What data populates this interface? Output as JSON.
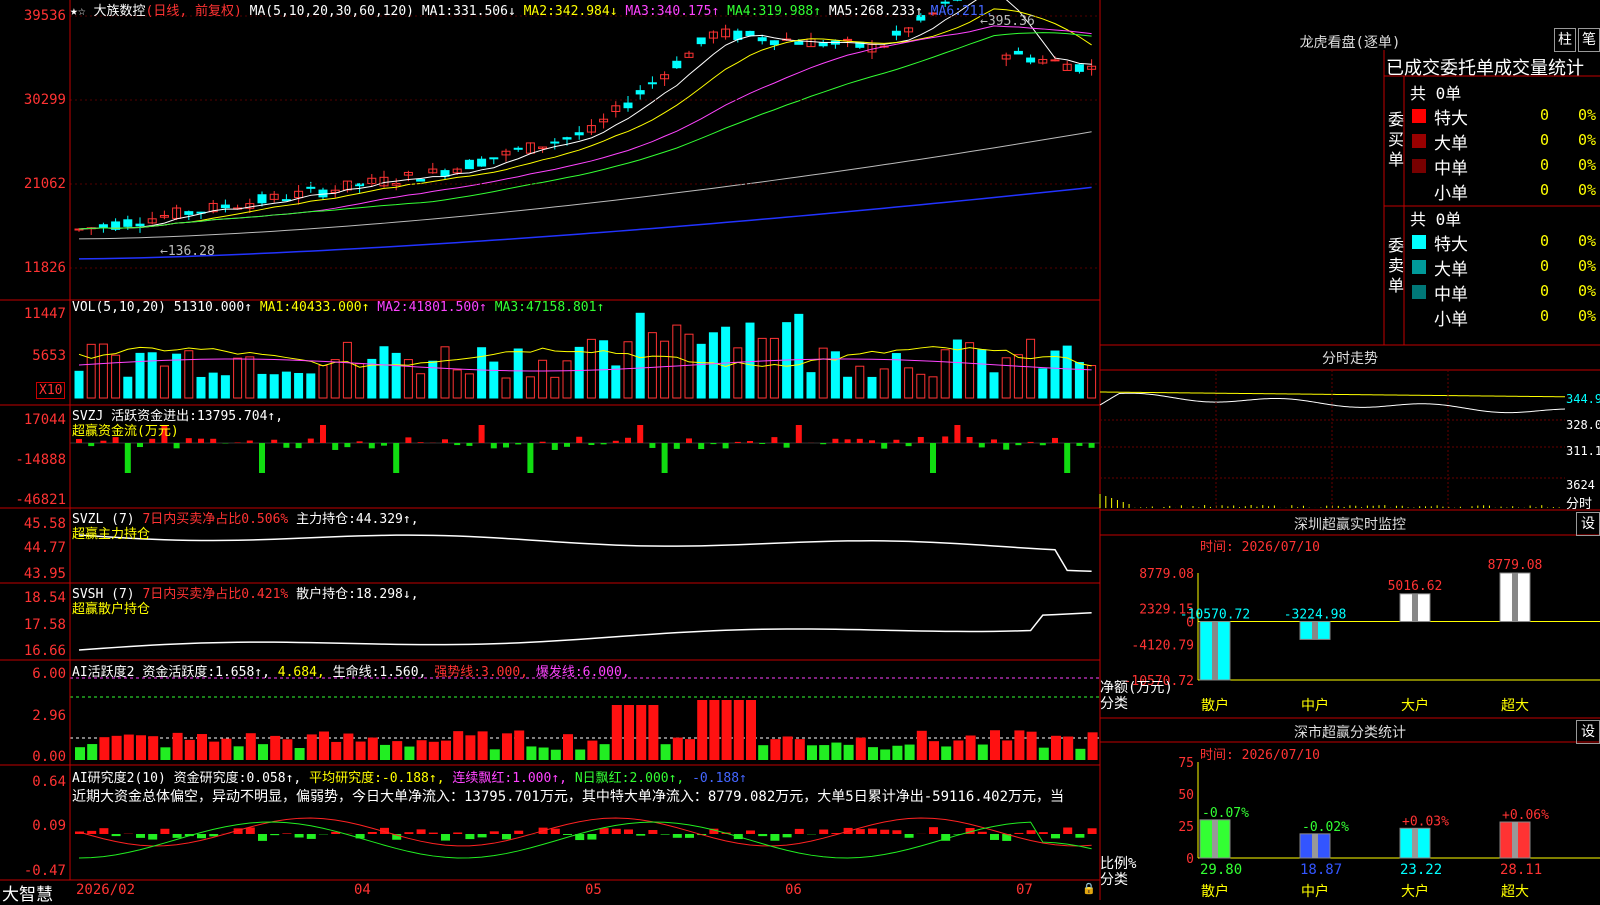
{
  "brand": "大智慧",
  "kline": {
    "title": "大族数控",
    "mode": "(日线, 前复权)",
    "ma_label": "MA(5,10,20,30,60,120)",
    "ma": [
      {
        "name": "MA1:",
        "value": "331.506↓"
      },
      {
        "name": "MA2:",
        "value": "342.984↓"
      },
      {
        "name": "MA3:",
        "value": "340.175↑"
      },
      {
        "name": "MA4:",
        "value": "319.988↑"
      },
      {
        "name": "MA5:",
        "value": "268.233↑"
      },
      {
        "name": "MA6:",
        "value": "211."
      }
    ],
    "y_ticks": [
      "39536",
      "30299",
      "21062",
      "11826"
    ],
    "high_label": "395.36",
    "low_label": "136.28"
  },
  "vol": {
    "label": "VOL(5,10,20)",
    "value": "51310.000↑",
    "ma": [
      {
        "name": "MA1:",
        "value": "40433.000↑"
      },
      {
        "name": "MA2:",
        "value": "41801.500↑"
      },
      {
        "name": "MA3:",
        "value": "47158.801↑"
      }
    ],
    "y_ticks": [
      "11447",
      "5653"
    ],
    "unit": "X10"
  },
  "svzj": {
    "label": "SVZJ",
    "desc": "活跃资金进出:",
    "value": "13795.704↑,",
    "sub": "超赢资金流(万元)",
    "y_ticks": [
      "17044",
      "-14888",
      "-46821"
    ]
  },
  "svzl": {
    "label": "SVZL (7)",
    "desc": "7日内买卖净占比0.506%",
    "name": "主力持仓:",
    "value": "44.329↑,",
    "sub": "超赢主力持仓",
    "y_ticks": [
      "45.58",
      "44.77",
      "43.95"
    ]
  },
  "svsh": {
    "label": "SVSH (7)",
    "desc": "7日内买卖净占比0.421%",
    "name": "散户持仓:",
    "value": "18.298↓,",
    "sub": "超赢散户持仓",
    "y_ticks": [
      "18.54",
      "17.58",
      "16.66"
    ]
  },
  "active": {
    "label": "AI活跃度2",
    "a_name": "资金活跃度:",
    "a_val": "1.658↑,",
    "b_val": "4.684,",
    "c_name": "生命线:",
    "c_val": "1.560,",
    "d_name": "强势线:",
    "d_val": "3.000,",
    "e_name": "爆发线:",
    "e_val": "6.000,",
    "y_ticks": [
      "6.00",
      "2.96",
      "0.00"
    ]
  },
  "research": {
    "label": "AI研究度2(10)",
    "a_name": "资金研究度:",
    "a_val": "0.058↑,",
    "b_name": "平均研究度:",
    "b_val": "-0.188↑,",
    "c_name": "连续飘红:",
    "c_val": "1.000↑,",
    "d_name": "N日飘红:",
    "d_val": "2.000↑,",
    "e_val": "-0.188↑",
    "comment": "近期大资金总体偏空，异动不明显，偏弱势，今日大单净流入：13795.701万元，其中特大单净流入：8779.082万元，大单5日累计净出-59116.402万元，当",
    "y_ticks": [
      "0.64",
      "0.09",
      "-0.47"
    ]
  },
  "dates": [
    "2026/02",
    "04",
    "05",
    "06",
    "07"
  ],
  "lhb": {
    "title": "龙虎看盘(逐单)",
    "btn1": "柱",
    "btn2": "笔",
    "subtitle": "已成交委托单成交量统计",
    "buy": {
      "side": "委买单",
      "total": "共 0单",
      "rows": [
        {
          "name": "特大",
          "qty": "0",
          "pct": "0%",
          "color": "#ff0000"
        },
        {
          "name": "大单",
          "qty": "0",
          "pct": "0%",
          "color": "#990000"
        },
        {
          "name": "中单",
          "qty": "0",
          "pct": "0%",
          "color": "#770000"
        },
        {
          "name": "小单",
          "qty": "0",
          "pct": "0%",
          "color": "#000000"
        }
      ]
    },
    "sell": {
      "side": "委卖单",
      "total": "共 0单",
      "rows": [
        {
          "name": "特大",
          "qty": "0",
          "pct": "0%",
          "color": "#00ffff"
        },
        {
          "name": "大单",
          "qty": "0",
          "pct": "0%",
          "color": "#009999"
        },
        {
          "name": "中单",
          "qty": "0",
          "pct": "0%",
          "color": "#007777"
        },
        {
          "name": "小单",
          "qty": "0",
          "pct": "0%",
          "color": "#000000"
        }
      ]
    }
  },
  "intraday": {
    "title": "分时走势",
    "y_ticks": [
      "344.9",
      "328.0",
      "311.1",
      "3624"
    ],
    "label": "分时"
  },
  "monitor": {
    "title": "深圳超赢实时监控",
    "btn": "设",
    "time": "时间: 2026/07/10",
    "y_ticks": [
      "8779.08",
      "2329.15",
      "0",
      "-4120.79",
      "-10570.72"
    ],
    "ylabel": "净额(万元)",
    "xlabel": "分类",
    "bars": [
      {
        "name": "散户",
        "value": -10570.72,
        "label": "-10570.72",
        "color": "#00ffff"
      },
      {
        "name": "中户",
        "value": -3224.98,
        "label": "-3224.98",
        "color": "#00ffff"
      },
      {
        "name": "大户",
        "value": 5016.62,
        "label": "5016.62",
        "color": "#ffffff"
      },
      {
        "name": "超大",
        "value": 8779.08,
        "label": "8779.08",
        "color": "#ffffff"
      }
    ]
  },
  "classify": {
    "title": "深市超赢分类统计",
    "btn": "设",
    "time": "时间: 2026/07/10",
    "y_ticks": [
      "75",
      "50",
      "25",
      "0"
    ],
    "ylabel": "比例%",
    "xlabel": "分类",
    "bars": [
      {
        "name": "散户",
        "value": 29.8,
        "label": "29.80",
        "change": "-0.07%",
        "color": "#33ff33"
      },
      {
        "name": "中户",
        "value": 18.87,
        "label": "18.87",
        "change": "-0.02%",
        "color": "#3355ff"
      },
      {
        "name": "大户",
        "value": 23.22,
        "label": "23.22",
        "change": "+0.03%",
        "color": "#00ffff"
      },
      {
        "name": "超大",
        "value": 28.11,
        "label": "28.11",
        "change": "+0.06%",
        "color": "#ff3333"
      }
    ]
  }
}
